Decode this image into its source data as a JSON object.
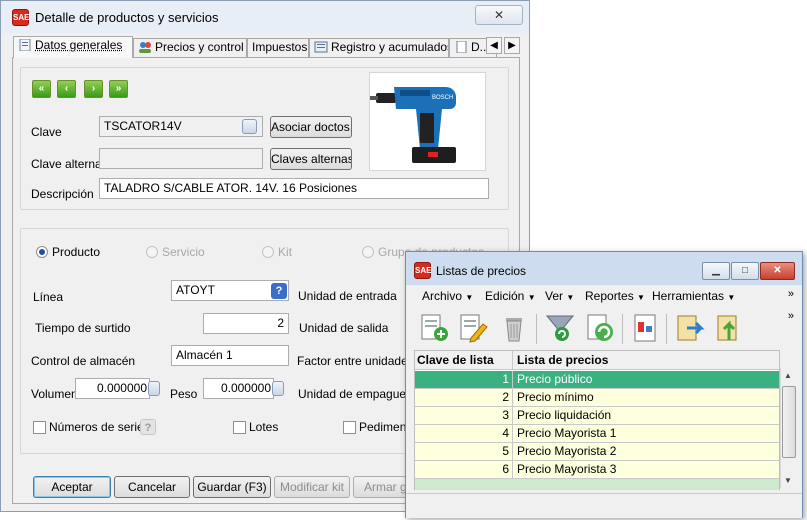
{
  "main_window": {
    "title": "Detalle de productos y servicios",
    "close_label": "✕",
    "tabs": [
      {
        "label": "Datos generales"
      },
      {
        "label": "Precios y control"
      },
      {
        "label": "Impuestos"
      },
      {
        "label": "Registro y acumulados"
      },
      {
        "label": "D..."
      }
    ],
    "nav": {
      "first": "«",
      "prev": "‹",
      "next": "›",
      "last": "»"
    },
    "fields": {
      "clave_label": "Clave",
      "clave_value": "TSCATOR14V",
      "clave_alterna_label": "Clave alterna",
      "clave_alterna_value": "",
      "descripcion_label": "Descripción",
      "descripcion_value": "TALADRO S/CABLE ATOR. 14V. 16 Posiciones"
    },
    "buttons": {
      "asociar": "Asociar doctos.",
      "claves_alternas": "Claves alternas",
      "aceptar": "Aceptar",
      "cancelar": "Cancelar",
      "guardar": "Guardar (F3)",
      "modificar_kit": "Modificar kit",
      "armar": "Armar gru"
    },
    "type_options": {
      "producto": "Producto",
      "servicio": "Servicio",
      "kit": "Kit",
      "grupo": "Grupo de productos"
    },
    "details": {
      "linea_label": "Línea",
      "linea_value": "ATOYT",
      "tiempo_label": "Tiempo de surtido",
      "tiempo_value": "2",
      "control_label": "Control de almacén",
      "control_value": "Almacén 1",
      "volumen_label": "Volumen",
      "volumen_value": "0.000000",
      "peso_label": "Peso",
      "peso_value": "0.000000",
      "unidad_entrada": "Unidad de entrada",
      "unidad_salida": "Unidad de salida",
      "factor": "Factor entre unidades",
      "unidad_empaque": "Unidad de empague",
      "numeros_serie": "Números de serie",
      "lotes": "Lotes",
      "pedimentos": "Pedimentos"
    },
    "help_icon": "?"
  },
  "price_window": {
    "title": "Listas de precios",
    "controls": {
      "minimize": "▁",
      "maximize": "□",
      "close": "✕"
    },
    "menus": [
      {
        "label": "Archivo"
      },
      {
        "label": "Edición"
      },
      {
        "label": "Ver"
      },
      {
        "label": "Reportes"
      },
      {
        "label": "Herramientas"
      }
    ],
    "menu_overflow": "»",
    "toolbar_overflow": "»",
    "columns": {
      "clave": "Clave de lista",
      "lista": "Lista de precios"
    },
    "rows": [
      {
        "clave": "1",
        "nombre": "Precio público"
      },
      {
        "clave": "2",
        "nombre": "Precio mínimo"
      },
      {
        "clave": "3",
        "nombre": "Precio liquidación"
      },
      {
        "clave": "4",
        "nombre": "Precio Mayorista 1"
      },
      {
        "clave": "5",
        "nombre": "Precio Mayorista 2"
      },
      {
        "clave": "6",
        "nombre": "Precio Mayorista 3"
      }
    ]
  },
  "colors": {
    "selected_row": "#3bb081",
    "row_background": "#feffdc",
    "title_bar": "#cddcee"
  }
}
